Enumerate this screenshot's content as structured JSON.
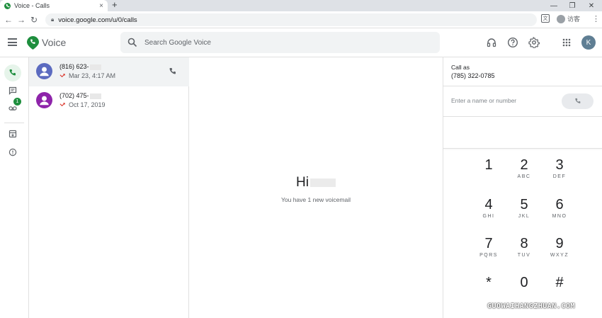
{
  "browser": {
    "tab_title": "Voice - Calls",
    "tab_close": "×",
    "new_tab": "+",
    "url": "voice.google.com/u/0/calls",
    "profile_label": "访客",
    "win_min": "—",
    "win_restore": "❐",
    "win_close": "✕",
    "back": "←",
    "forward": "→",
    "reload": "↻",
    "kebab": "⋮",
    "translate": "文"
  },
  "header": {
    "app_name": "Voice",
    "search_placeholder": "Search Google Voice",
    "avatar_initial": "K"
  },
  "rail": {
    "voicemail_badge": "1"
  },
  "calls": [
    {
      "number": "(816) 623-",
      "date": "Mar 23, 4:17 AM",
      "avatar_color": "#5c6bc0"
    },
    {
      "number": "(702) 475-",
      "date": "Oct 17, 2019",
      "avatar_color": "#8e24aa"
    }
  ],
  "main": {
    "greeting": "Hi",
    "voicemail_note": "You have 1 new voicemail"
  },
  "dialer": {
    "call_as_label": "Call as",
    "call_as_number": "(785) 322-0785",
    "input_placeholder": "Enter a name or number",
    "keys": [
      {
        "d": "1",
        "l": ""
      },
      {
        "d": "2",
        "l": "ABC"
      },
      {
        "d": "3",
        "l": "DEF"
      },
      {
        "d": "4",
        "l": "GHI"
      },
      {
        "d": "5",
        "l": "JKL"
      },
      {
        "d": "6",
        "l": "MNO"
      },
      {
        "d": "7",
        "l": "PQRS"
      },
      {
        "d": "8",
        "l": "TUV"
      },
      {
        "d": "9",
        "l": "WXYZ"
      },
      {
        "d": "*",
        "l": ""
      },
      {
        "d": "0",
        "l": ""
      },
      {
        "d": "#",
        "l": ""
      }
    ]
  },
  "colors": {
    "accent_green": "#1e8e3e",
    "missed_red": "#d93025"
  },
  "watermark": "GUOWAIHANGZHUAN.COM"
}
